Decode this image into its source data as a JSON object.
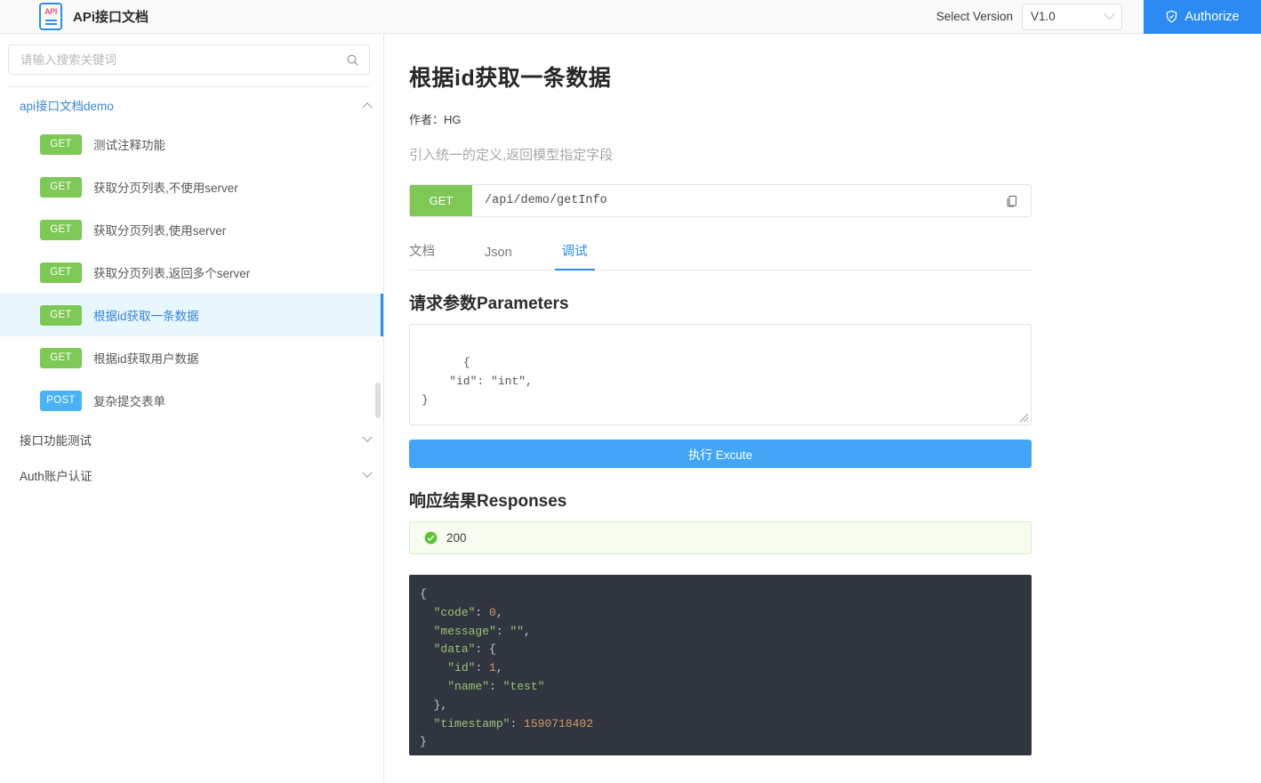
{
  "header": {
    "logo_text": "API",
    "brand_title": "APi接口文档",
    "select_version_label": "Select Version",
    "version_value": "V1.0",
    "authorize_label": "Authorize"
  },
  "sidebar": {
    "search_placeholder": "请输入搜索关键词",
    "search_value": "",
    "groups": [
      {
        "label": "api接口文档demo",
        "expanded": true,
        "items": [
          {
            "method": "GET",
            "name": "测试注释功能",
            "selected": false
          },
          {
            "method": "GET",
            "name": "获取分页列表,不使用server",
            "selected": false
          },
          {
            "method": "GET",
            "name": "获取分页列表,使用server",
            "selected": false
          },
          {
            "method": "GET",
            "name": "获取分页列表,返回多个server",
            "selected": false
          },
          {
            "method": "GET",
            "name": "根据id获取一条数据",
            "selected": true
          },
          {
            "method": "GET",
            "name": "根据id获取用户数据",
            "selected": false
          },
          {
            "method": "POST",
            "name": "复杂提交表单",
            "selected": false
          }
        ]
      },
      {
        "label": "接口功能测试",
        "expanded": false,
        "items": []
      },
      {
        "label": "Auth账户认证",
        "expanded": false,
        "items": []
      }
    ]
  },
  "main": {
    "title": "根据id获取一条数据",
    "author_label": "作者：",
    "author_value": "HG",
    "description": "引入统一的定义,返回模型指定字段",
    "endpoint": {
      "method": "GET",
      "path": "/api/demo/getInfo"
    },
    "tabs": [
      {
        "label": "文档",
        "active": false
      },
      {
        "label": "Json",
        "active": false
      },
      {
        "label": "调试",
        "active": true
      }
    ],
    "parameters": {
      "title": "请求参数Parameters",
      "value": "{\n    \"id\": \"int\",\n}"
    },
    "execute_label": "执行 Excute",
    "responses": {
      "title": "响应结果Responses",
      "status_code": "200",
      "status_ok": true,
      "body_lines": [
        {
          "indent": 0,
          "parts": [
            {
              "t": "{",
              "c": "jp"
            }
          ]
        },
        {
          "indent": 1,
          "parts": [
            {
              "t": "\"code\"",
              "c": "jk"
            },
            {
              "t": ": ",
              "c": "jp"
            },
            {
              "t": "0",
              "c": "jn"
            },
            {
              "t": ",",
              "c": "jp"
            }
          ]
        },
        {
          "indent": 1,
          "parts": [
            {
              "t": "\"message\"",
              "c": "jk"
            },
            {
              "t": ": ",
              "c": "jp"
            },
            {
              "t": "\"\"",
              "c": "js"
            },
            {
              "t": ",",
              "c": "jp"
            }
          ]
        },
        {
          "indent": 1,
          "parts": [
            {
              "t": "\"data\"",
              "c": "jk"
            },
            {
              "t": ": {",
              "c": "jp"
            }
          ]
        },
        {
          "indent": 2,
          "parts": [
            {
              "t": "\"id\"",
              "c": "jk"
            },
            {
              "t": ": ",
              "c": "jp"
            },
            {
              "t": "1",
              "c": "jn"
            },
            {
              "t": ",",
              "c": "jp"
            }
          ]
        },
        {
          "indent": 2,
          "parts": [
            {
              "t": "\"name\"",
              "c": "jk"
            },
            {
              "t": ": ",
              "c": "jp"
            },
            {
              "t": "\"test\"",
              "c": "js"
            }
          ]
        },
        {
          "indent": 1,
          "parts": [
            {
              "t": "},",
              "c": "jp"
            }
          ]
        },
        {
          "indent": 1,
          "parts": [
            {
              "t": "\"timestamp\"",
              "c": "jk"
            },
            {
              "t": ": ",
              "c": "jp"
            },
            {
              "t": "1590718402",
              "c": "jn"
            }
          ]
        },
        {
          "indent": 0,
          "parts": [
            {
              "t": "}",
              "c": "jp"
            }
          ]
        }
      ]
    }
  },
  "colors": {
    "accent_blue": "#2b8bf2",
    "get_green": "#7ec855",
    "post_blue": "#49b3f5",
    "execute_blue": "#42a5f5",
    "code_bg": "#31353f"
  }
}
